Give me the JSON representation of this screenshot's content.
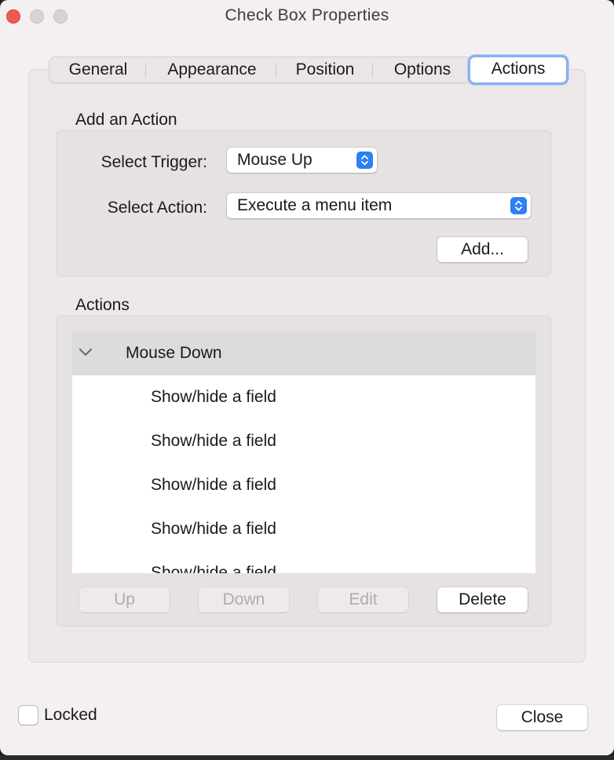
{
  "window": {
    "title": "Check Box Properties"
  },
  "tabs": [
    {
      "label": "General"
    },
    {
      "label": "Appearance"
    },
    {
      "label": "Position"
    },
    {
      "label": "Options"
    },
    {
      "label": "Actions",
      "active": true
    }
  ],
  "add_action": {
    "section_title": "Add an Action",
    "trigger_label": "Select Trigger:",
    "trigger_value": "Mouse Up",
    "action_label": "Select Action:",
    "action_value": "Execute a menu item",
    "add_button": "Add..."
  },
  "actions": {
    "section_title": "Actions",
    "group": {
      "name": "Mouse Down",
      "expanded": true
    },
    "items": [
      "Show/hide a field",
      "Show/hide a field",
      "Show/hide a field",
      "Show/hide a field",
      "Show/hide a field"
    ],
    "buttons": {
      "up": "Up",
      "down": "Down",
      "edit": "Edit",
      "delete": "Delete"
    }
  },
  "footer": {
    "locked_label": "Locked",
    "locked_checked": false,
    "close_button": "Close"
  },
  "colors": {
    "accent": "#2f7ff5",
    "close_light": "#ee5a52",
    "focus_ring": "#8ab0ef"
  }
}
